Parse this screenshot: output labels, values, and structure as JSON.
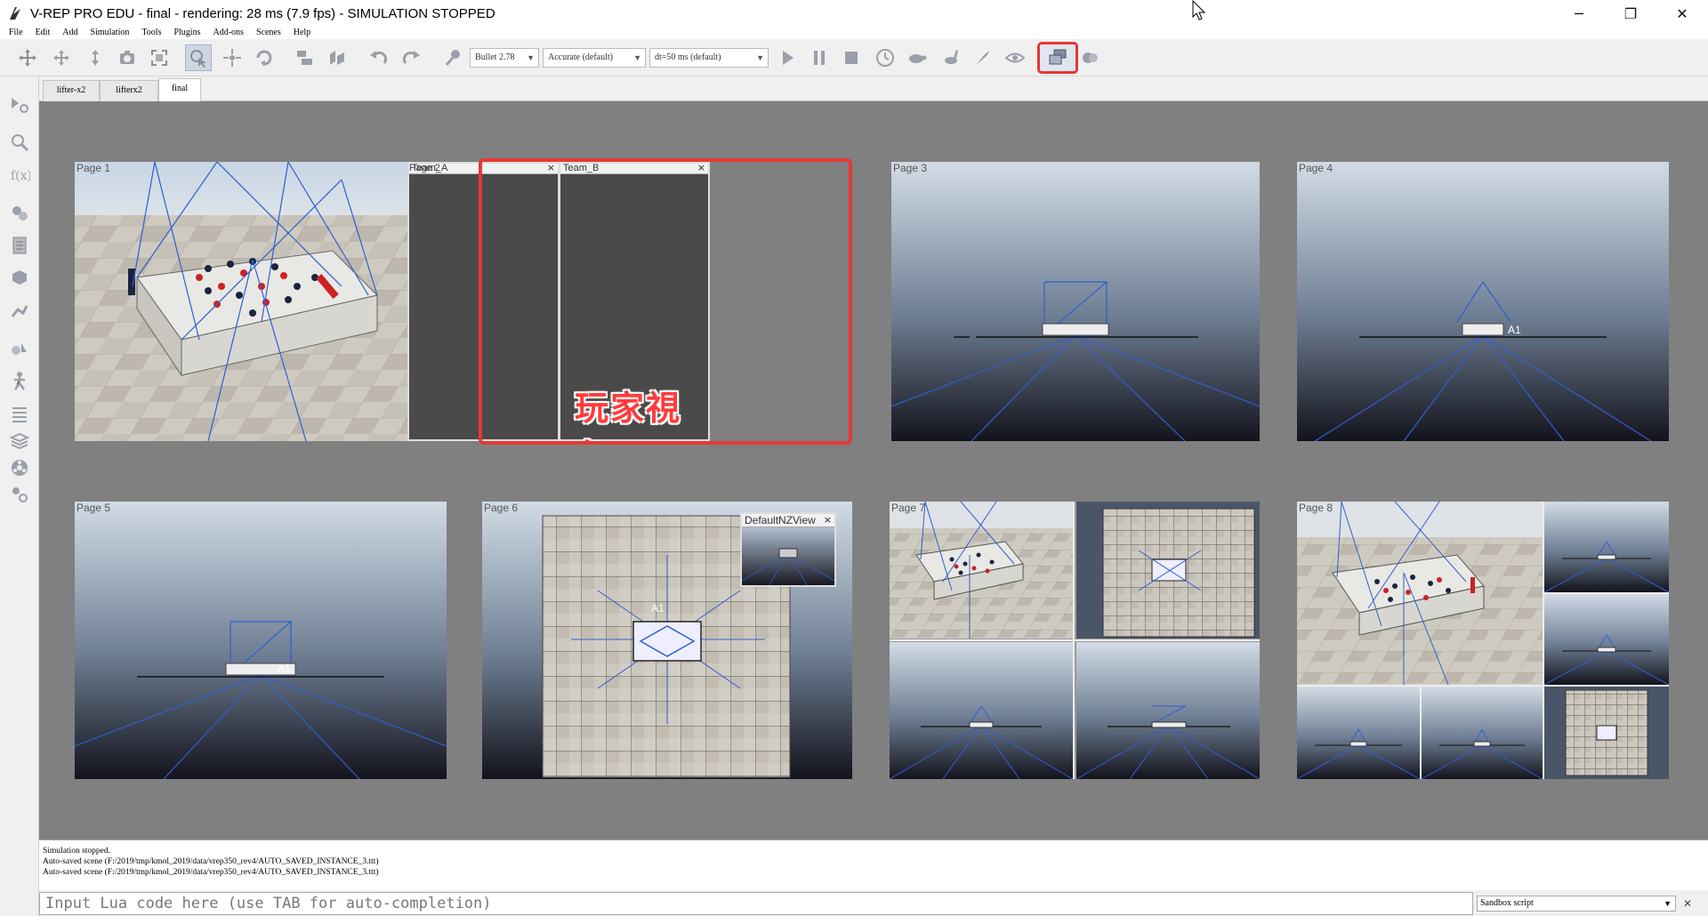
{
  "window": {
    "title": "V-REP PRO EDU - final - rendering: 28 ms (7.9 fps) - SIMULATION STOPPED",
    "minimize": "─",
    "restore": "❐",
    "close": "✕"
  },
  "menu": [
    "File",
    "Edit",
    "Add",
    "Simulation",
    "Tools",
    "Plugins",
    "Add-ons",
    "Scenes",
    "Help"
  ],
  "toolbar": {
    "engine": "Bullet 2.78",
    "accuracy": "Accurate (default)",
    "timestep": "dt=50 ms (default)",
    "icons": [
      "camera-pan-icon",
      "camera-rotate-icon",
      "camera-shift-icon",
      "camera-angle-icon",
      "fit-to-view-icon",
      "click-selection-icon",
      "object-shift-icon",
      "object-rotate-icon",
      "assemble-icon",
      "transfer-dna-icon",
      "undo-icon",
      "redo-icon",
      "dynamics-settings-icon",
      "start-simulation-icon",
      "pause-simulation-icon",
      "stop-simulation-icon",
      "real-time-icon",
      "slow-down-icon",
      "speed-up-icon",
      "threaded-rendering-icon",
      "visualization-toggle-icon",
      "page-selector-icon",
      "scene-selector-icon"
    ]
  },
  "sidebar_icons": [
    "simulation-settings-icon",
    "selection-icon",
    "scene-hierarchy-icon",
    "model-browser-icon",
    "layers-icon",
    "calculation-modules-icon",
    "collections-icon",
    "scripts-icon",
    "shapes-icon",
    "history-icon",
    "user-settings-icon",
    "path-planning-icon",
    "motion-planning-icon"
  ],
  "tabs": [
    {
      "label": "lifter-x2",
      "active": false
    },
    {
      "label": "lifterx2",
      "active": false
    },
    {
      "label": "final",
      "active": true
    }
  ],
  "pages": [
    {
      "label": "Page 1"
    },
    {
      "label": "Page 2",
      "views": [
        {
          "title": "Team_A"
        },
        {
          "title": "Team_B"
        }
      ],
      "overlay": "玩家視角"
    },
    {
      "label": "Page 3"
    },
    {
      "label": "Page 4"
    },
    {
      "label": "Page 5"
    },
    {
      "label": "Page 6",
      "inset_title": "DefaultNZView"
    },
    {
      "label": "Page 7"
    },
    {
      "label": "Page 8"
    }
  ],
  "scene_labels": {
    "marker": "A1"
  },
  "console": [
    "Simulation stopped.",
    "Auto-saved scene (F:/2019/tmp/kmol_2019/data/vrep350_rev4/AUTO_SAVED_INSTANCE_3.ttt)",
    "Auto-saved scene (F:/2019/tmp/kmol_2019/data/vrep350_rev4/AUTO_SAVED_INSTANCE_3.ttt)"
  ],
  "lua": {
    "placeholder": "Input Lua code here (use TAB for auto-completion)",
    "script_type": "Sandbox script"
  },
  "colors": {
    "highlight": "#e53935",
    "laser": "#2f5fd0"
  }
}
